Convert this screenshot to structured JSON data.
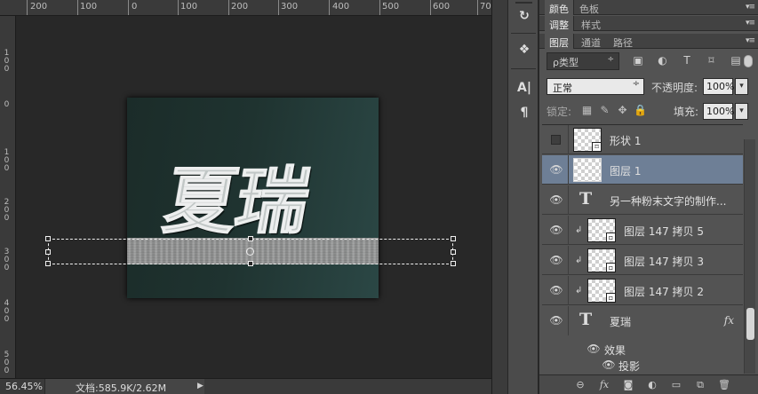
{
  "ruler": {
    "top_labels": [
      "200",
      "100",
      "0",
      "100",
      "200",
      "300",
      "400",
      "500",
      "600",
      "70"
    ],
    "left_labels": [
      "100",
      "0",
      "100",
      "200",
      "300",
      "400",
      "500"
    ]
  },
  "canvas": {
    "document_text": "夏瑞"
  },
  "status": {
    "zoom": "56.45%",
    "doc_info": "文档:585.9K/2.62M",
    "arrow": "▶"
  },
  "dock": {
    "items": [
      {
        "icon": "history-icon",
        "glyph": "↻"
      },
      {
        "icon": "3d-icon",
        "glyph": "❖"
      },
      {
        "icon": "character-icon",
        "glyph": "A|"
      },
      {
        "icon": "paragraph-icon",
        "glyph": "¶"
      }
    ]
  },
  "panels": {
    "tabs_row1": [
      "颜色",
      "色板"
    ],
    "tabs_row2": [
      "调整",
      "样式"
    ],
    "tabs_row3": [
      "图层",
      "通道",
      "路径"
    ],
    "menu_glyph": "▾≡",
    "filter": {
      "label": "ρ类型",
      "caret": "÷",
      "icons": [
        {
          "name": "pixel-filter-icon",
          "glyph": "▣"
        },
        {
          "name": "adjustment-filter-icon",
          "glyph": "◐"
        },
        {
          "name": "type-filter-icon",
          "glyph": "T"
        },
        {
          "name": "shape-filter-icon",
          "glyph": "⌑"
        },
        {
          "name": "smartobject-filter-icon",
          "glyph": "▤"
        }
      ]
    },
    "blend_mode": "正常",
    "blend_caret": "÷",
    "opacity_label": "不透明度:",
    "opacity_value": "100%",
    "fill_label": "填充:",
    "fill_value": "100%",
    "lock_label": "锁定:",
    "dropdown_glyph": "▾"
  },
  "layers": [
    {
      "name": "形状 1",
      "visible": false,
      "type": "shape",
      "selected": false
    },
    {
      "name": "图层 1",
      "visible": true,
      "type": "pixel",
      "selected": true
    },
    {
      "name": "另一种粉末文字的制作...",
      "visible": true,
      "type": "text",
      "selected": false
    },
    {
      "name": "图层 147 拷贝 5",
      "visible": true,
      "type": "smart",
      "clipped": true,
      "selected": false
    },
    {
      "name": "图层 147 拷贝 3",
      "visible": true,
      "type": "smart",
      "clipped": true,
      "selected": false
    },
    {
      "name": "图层 147 拷贝 2",
      "visible": true,
      "type": "smart",
      "clipped": true,
      "selected": false
    },
    {
      "name": "夏瑞",
      "visible": true,
      "type": "text",
      "fx": "fx",
      "selected": false
    }
  ],
  "effects": {
    "label": "效果",
    "items": [
      "投影"
    ]
  },
  "glyphs": {
    "eye": "👁",
    "clip": "↲",
    "text_layer": "T",
    "smart_badge": "▫"
  },
  "footer": {
    "icons": [
      {
        "name": "link-layers-icon",
        "glyph": "⊖"
      },
      {
        "name": "fx-icon",
        "glyph": "fx"
      },
      {
        "name": "add-mask-icon",
        "glyph": "◙"
      },
      {
        "name": "adjustment-layer-icon",
        "glyph": "◐"
      },
      {
        "name": "new-group-icon",
        "glyph": "▭"
      },
      {
        "name": "new-layer-icon",
        "glyph": "⧉"
      },
      {
        "name": "delete-layer-icon",
        "glyph": "🗑"
      }
    ]
  },
  "colors": {
    "selected_layer": "#6e7f96",
    "panel_bg": "#535353",
    "canvas_bg": "#282828"
  }
}
